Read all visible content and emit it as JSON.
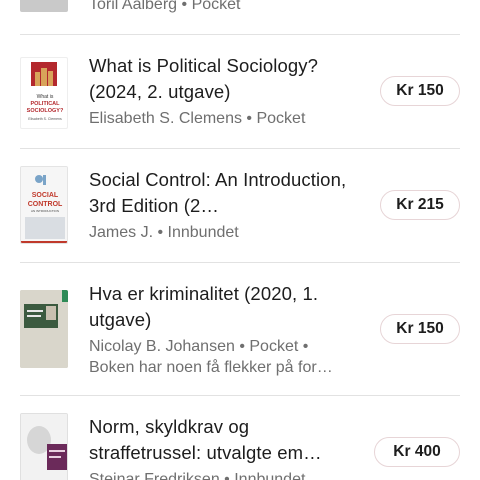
{
  "items": [
    {
      "title": "",
      "author": "Toril Aalberg",
      "format": "Pocket",
      "extra": "",
      "price": ""
    },
    {
      "title": "What is Political Sociology? (2024, 2. utgave)",
      "author": "Elisabeth S. Clemens",
      "format": "Pocket",
      "extra": "",
      "price": "Kr 150",
      "cover": {
        "line1": "What is",
        "line2": "POLITICAL",
        "line3": "SOCIOLOGY?",
        "author": "Elisabeth S. Clemens",
        "accent": "#b3282d"
      }
    },
    {
      "title": "Social Control: An Introduction, 3rd Edition (2…",
      "author": "James J.",
      "format": "Innbundet",
      "extra": "",
      "price": "Kr 215",
      "cover": {
        "line1": "SOCIAL",
        "line2": "CONTROL",
        "line3": "AN INTRODUCTION",
        "accent": "#c0392b"
      }
    },
    {
      "title": "Hva er kriminalitet (2020, 1. utgave)",
      "author": "Nicolay B. Johansen",
      "format": "Pocket",
      "extra": "Boken har noen få flekker på for…",
      "price": "Kr 150",
      "cover": {
        "accent": "#2e8b57",
        "bg": "#d8d4c8"
      }
    },
    {
      "title": "Norm, skyldkrav og straffetrussel: utvalgte em…",
      "author": "Steinar Fredriksen",
      "format": "Innbundet",
      "extra": "",
      "price": "Kr 400",
      "cover": {
        "accent": "#6b2a5a"
      }
    }
  ],
  "separator": "•"
}
